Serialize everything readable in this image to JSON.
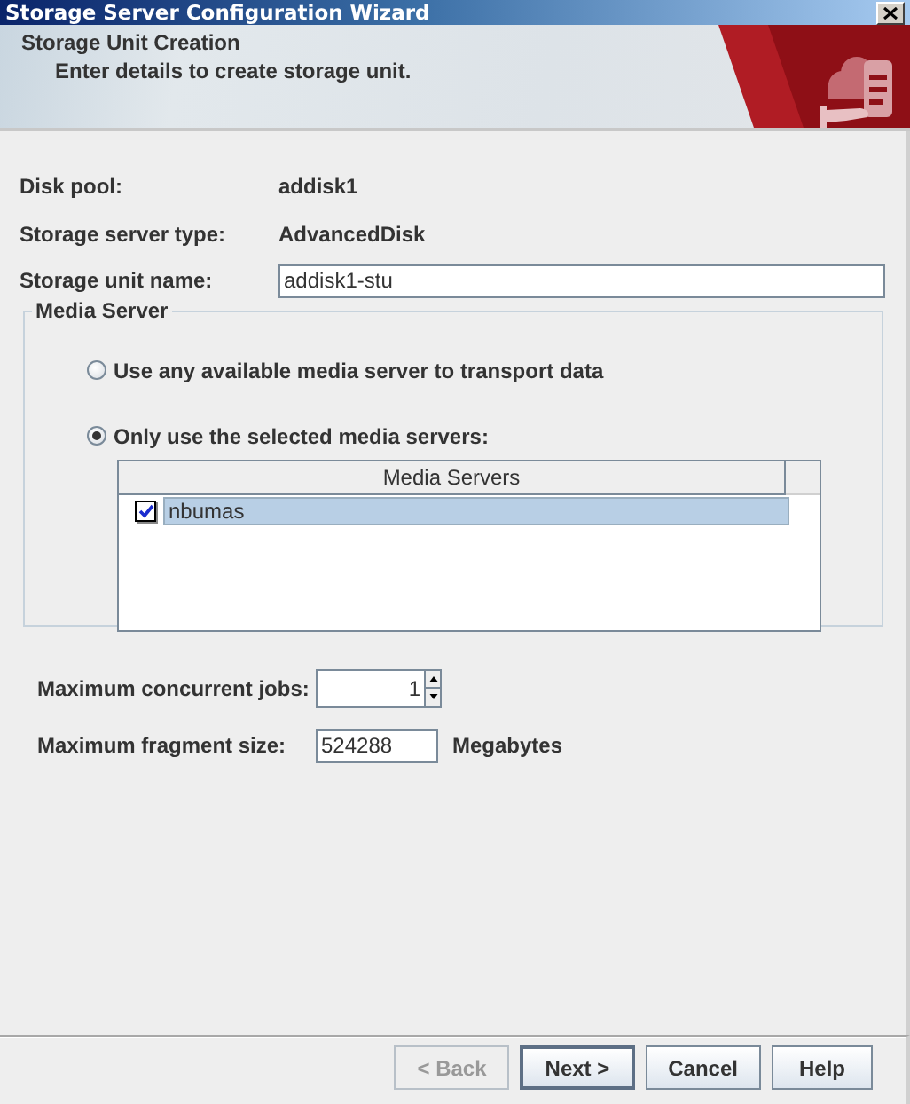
{
  "window": {
    "title": "Storage Server Configuration Wizard"
  },
  "header": {
    "title": "Storage Unit Creation",
    "subtitle": "Enter details to create storage unit."
  },
  "fields": [
    {
      "kind": "text",
      "label": "Disk pool:",
      "value": "addisk1"
    },
    {
      "kind": "text",
      "label": "Storage server type:",
      "value": "AdvancedDisk"
    },
    {
      "kind": "input",
      "label": "Storage unit name:",
      "value": "addisk1-stu"
    }
  ],
  "media_server": {
    "title": "Media Server",
    "options": [
      {
        "label": "Use any available media server to transport data",
        "selected": false
      },
      {
        "label": "Only use the selected media servers:",
        "selected": true
      }
    ],
    "table": {
      "columns": [
        "Media Servers"
      ],
      "rows": [
        {
          "name": "nbumas",
          "checked": true,
          "selected": true
        }
      ]
    }
  },
  "limits": [
    {
      "kind": "spinner",
      "label": "Maximum concurrent jobs:",
      "value": "1"
    },
    {
      "kind": "input",
      "label": "Maximum fragment size:",
      "value": "524288",
      "unit": "Megabytes"
    }
  ],
  "buttons": [
    {
      "label": "< Back",
      "disabled": true,
      "default": false
    },
    {
      "label": "Next >",
      "disabled": false,
      "default": true
    },
    {
      "label": "Cancel",
      "disabled": false,
      "default": false
    },
    {
      "label": "Help",
      "disabled": false,
      "default": false
    }
  ]
}
